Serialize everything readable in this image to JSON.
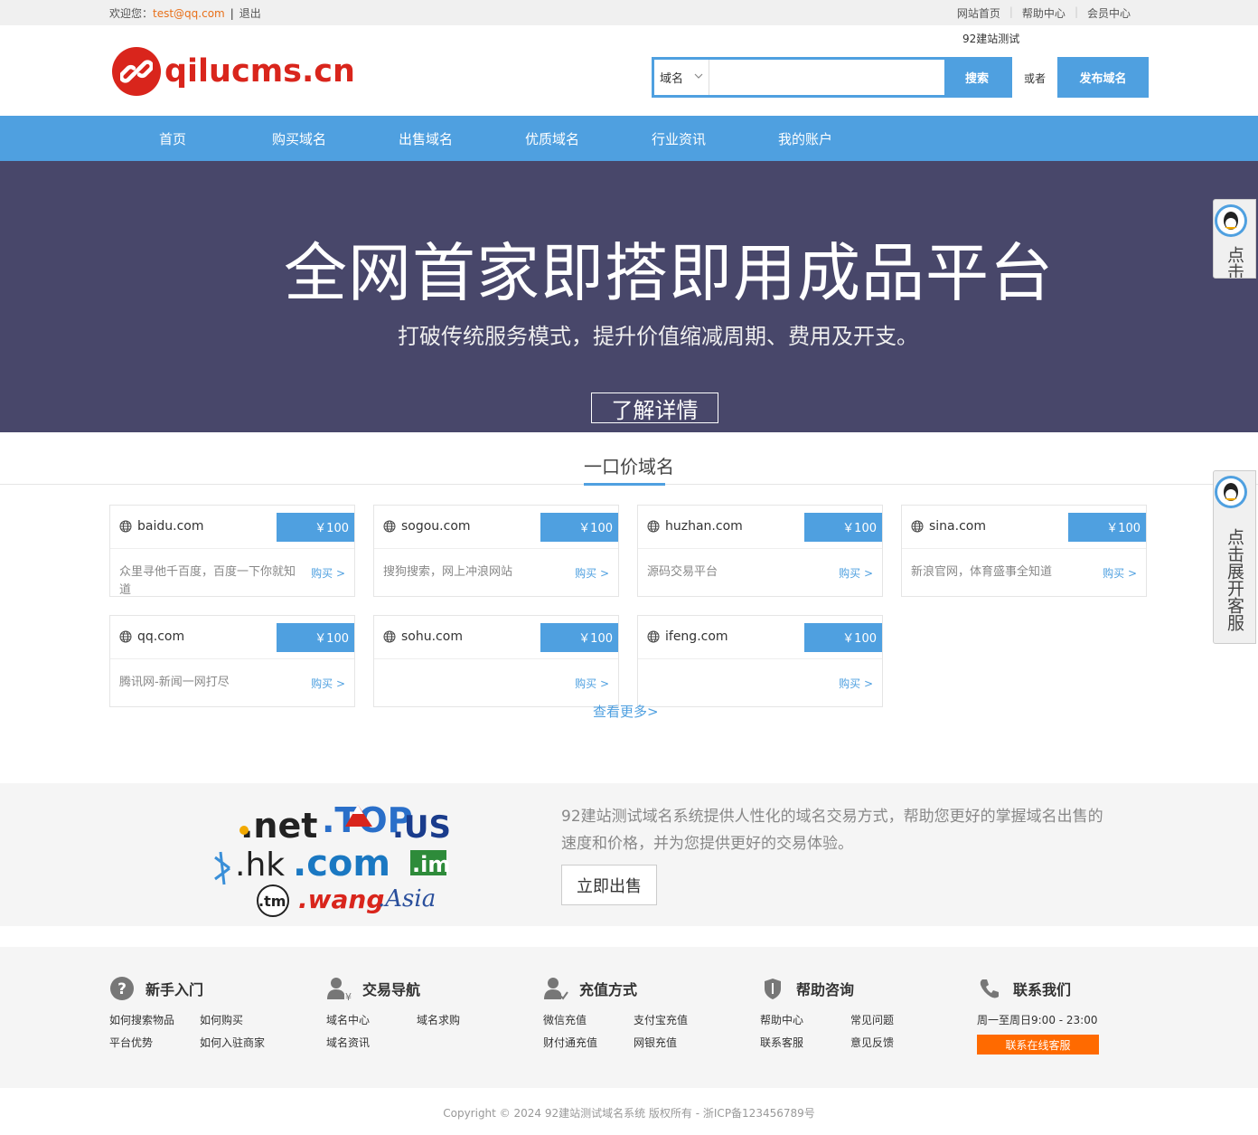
{
  "topbar": {
    "welcome": "欢迎您：",
    "email": "test@qq.com",
    "divider": "|",
    "logout": "退出",
    "links": [
      "网站首页",
      "帮助中心",
      "会员中心"
    ]
  },
  "header": {
    "logo_text": "qilucms.cn",
    "site_name": "92建站测试",
    "search": {
      "type_label": "域名",
      "value": "",
      "button": "搜索"
    },
    "or_text": "或者",
    "publish_button": "发布域名"
  },
  "nav": {
    "items": [
      "首页",
      "购买域名",
      "出售域名",
      "优质域名",
      "行业资讯",
      "我的账户"
    ]
  },
  "banner": {
    "title": "全网首家即搭即用成品平台",
    "subtitle": "打破传统服务模式，提升价值缩减周期、费用及开支。",
    "button": "了解详情"
  },
  "section": {
    "title": "一口价域名",
    "more": "查看更多>"
  },
  "domains": [
    {
      "name": "baidu.com",
      "price": "￥100",
      "desc": "众里寻他千百度，百度一下你就知道",
      "buy": "购买 >"
    },
    {
      "name": "sogou.com",
      "price": "￥100",
      "desc": "搜狗搜索，网上冲浪网站",
      "buy": "购买 >"
    },
    {
      "name": "huzhan.com",
      "price": "￥100",
      "desc": "源码交易平台",
      "buy": "购买 >"
    },
    {
      "name": "sina.com",
      "price": "￥100",
      "desc": "新浪官网，体育盛事全知道",
      "buy": "购买 >"
    },
    {
      "name": "qq.com",
      "price": "￥100",
      "desc": "腾讯网-新闻一网打尽",
      "buy": "购买 >"
    },
    {
      "name": "sohu.com",
      "price": "￥100",
      "desc": "",
      "buy": "购买 >"
    },
    {
      "name": "ifeng.com",
      "price": "￥100",
      "desc": "",
      "buy": "购买 >"
    }
  ],
  "promo": {
    "logos": [
      ".net",
      ".TOP",
      ".US",
      ".hk",
      ".com",
      ".im",
      ".tm",
      ".wang",
      ".Asia"
    ],
    "text": "92建站测试域名系统提供人性化的域名交易方式，帮助您更好的掌握域名出售的速度和价格，并为您提供更好的交易体验。",
    "button": "立即出售"
  },
  "footer": {
    "columns": [
      {
        "title": "新手入门",
        "icon": "question-icon",
        "links": [
          "如何搜索物品",
          "如何购买",
          "平台优势",
          "如何入驻商家"
        ]
      },
      {
        "title": "交易导航",
        "icon": "user-yuan-icon",
        "links": [
          "域名中心",
          "域名求购",
          "域名资讯"
        ]
      },
      {
        "title": "充值方式",
        "icon": "user-check-icon",
        "links": [
          "微信充值",
          "支付宝充值",
          "财付通充值",
          "网银充值"
        ]
      },
      {
        "title": "帮助咨询",
        "icon": "shield-icon",
        "links": [
          "帮助中心",
          "常见问题",
          "联系客服",
          "意见反馈"
        ]
      },
      {
        "title": "联系我们",
        "icon": "phone-icon",
        "hours": "周一至周日9:00 - 23:00",
        "button": "联系在线客服"
      }
    ],
    "copyright": "Copyright © 2024 92建站测试域名系统 版权所有 - 浙ICP备123456789号"
  },
  "side_service": {
    "collapsed_text": "点击",
    "expanded_text": "点击展开客服"
  },
  "colors": {
    "accent": "#4fa0e0",
    "banner_bg": "#48476a",
    "logo_red": "#d9251c",
    "orange": "#ff6a00"
  }
}
